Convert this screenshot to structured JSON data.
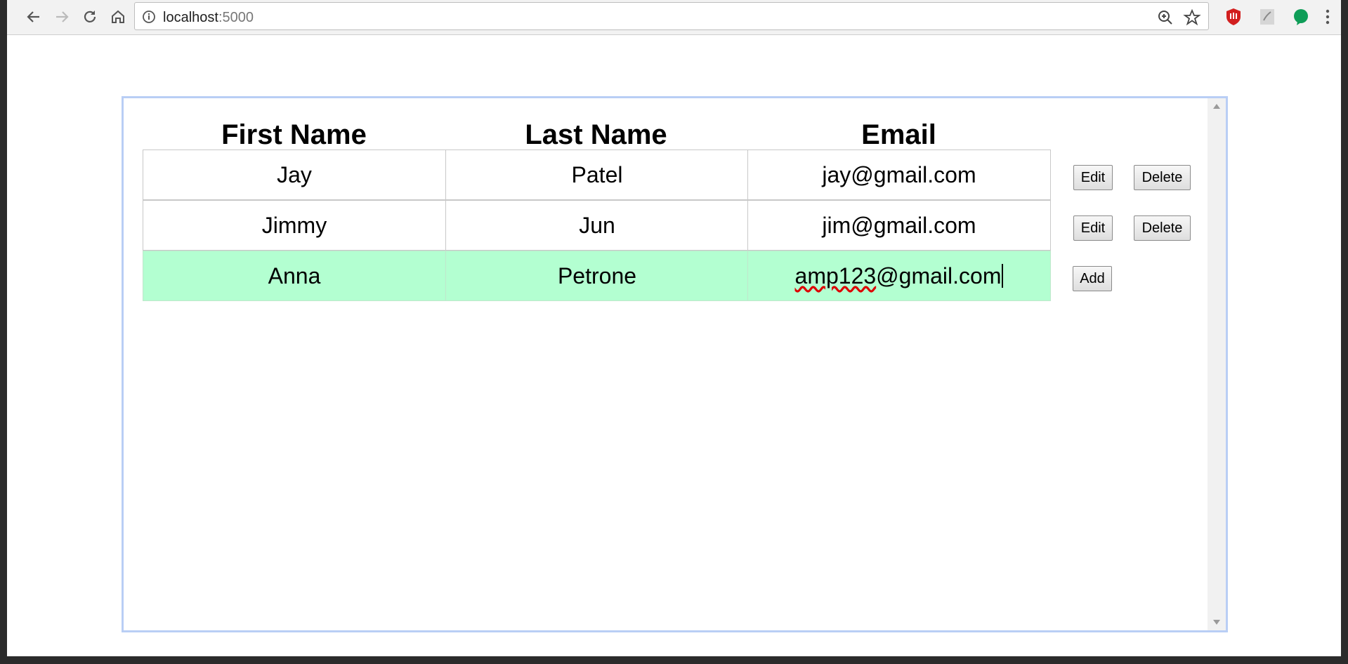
{
  "browser": {
    "url_host": "localhost",
    "url_port": ":5000"
  },
  "table": {
    "headers": [
      "First Name",
      "Last Name",
      "Email"
    ],
    "rows": [
      {
        "first": "Jay",
        "last": "Patel",
        "email": "jay@gmail.com",
        "edit": "Edit",
        "delete": "Delete"
      },
      {
        "first": "Jimmy",
        "last": "Jun",
        "email": "jim@gmail.com",
        "edit": "Edit",
        "delete": "Delete"
      }
    ],
    "new_row": {
      "first": "Anna",
      "last": "Petrone",
      "email_misspelled": "amp123",
      "email_rest": "@gmail.com",
      "add": "Add"
    }
  },
  "colors": {
    "new_row_bg": "#b3ffd1",
    "frame_border": "#b9cef5"
  }
}
